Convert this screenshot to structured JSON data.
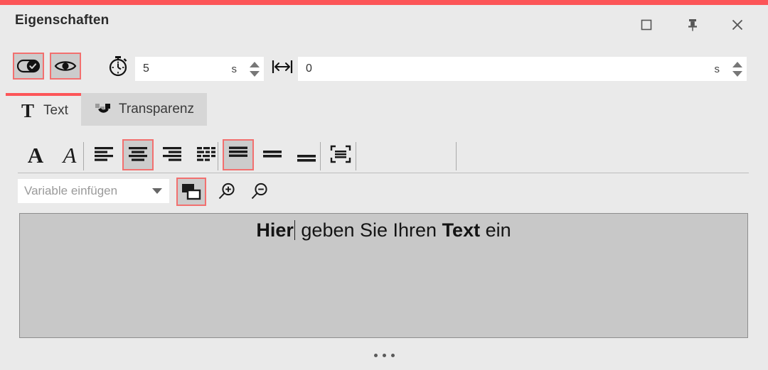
{
  "window": {
    "title": "Eigenschaften",
    "accent_color": "#fc5558",
    "background_color": "#eaeaea",
    "controls": [
      {
        "name": "maximize",
        "icon": "maximize-square-icon"
      },
      {
        "name": "pin",
        "icon": "pin-icon"
      },
      {
        "name": "close",
        "icon": "close-x-icon"
      }
    ]
  },
  "options_toolbar": {
    "toggles": [
      {
        "name": "state-toggle",
        "icon": "toggle-check-icon",
        "selected": true
      },
      {
        "name": "visibility-toggle",
        "icon": "eye-icon",
        "selected": true
      }
    ],
    "duration": {
      "icon": "stopwatch-icon",
      "value": "5",
      "unit": "s"
    },
    "delay": {
      "icon": "horizontal-arrows-icon",
      "value": "0",
      "unit": "s"
    }
  },
  "tabs": [
    {
      "label": "Text",
      "icon": "serif-t-icon",
      "glyph": "T",
      "active": true
    },
    {
      "label": "Transparenz",
      "icon": "transparency-icon",
      "active": false
    }
  ],
  "format_toolbar": {
    "buttons": [
      {
        "name": "bold",
        "icon": "bold-a-icon",
        "glyph": "A",
        "selected": false
      },
      {
        "name": "italic",
        "icon": "italic-a-icon",
        "glyph": "A",
        "selected": false
      },
      {
        "name": "align-left",
        "icon": "align-left-icon",
        "selected": false
      },
      {
        "name": "align-center",
        "icon": "align-center-icon",
        "selected": true
      },
      {
        "name": "align-right",
        "icon": "align-right-icon",
        "selected": false
      },
      {
        "name": "align-justify",
        "icon": "align-justify-icon",
        "selected": false
      },
      {
        "name": "valign-top",
        "icon": "vertical-align-top-icon",
        "selected": true
      },
      {
        "name": "valign-middle",
        "icon": "vertical-align-middle-icon",
        "selected": false
      },
      {
        "name": "valign-bottom",
        "icon": "vertical-align-bottom-icon",
        "selected": false
      },
      {
        "name": "fit-text",
        "icon": "fit-text-frame-icon",
        "selected": false
      }
    ],
    "color": {
      "name": "text-color",
      "value": "#000000",
      "highlighted": true
    },
    "font": {
      "icon": "tt-font-icon",
      "family": "Open Sans",
      "size": "36"
    }
  },
  "variable_row": {
    "variable_placeholder": "Variable einfügen",
    "buttons": [
      {
        "name": "duplicate-layer",
        "icon": "layers-duplicate-icon",
        "selected": true
      },
      {
        "name": "zoom-in",
        "icon": "zoom-in-magnifier-icon",
        "selected": false
      },
      {
        "name": "zoom-out",
        "icon": "zoom-out-magnifier-icon",
        "selected": false
      }
    ]
  },
  "text_canvas": {
    "segments": [
      {
        "text": "Hier",
        "bold": true
      },
      {
        "text": " geben Sie Ihren ",
        "bold": false
      },
      {
        "text": "Text",
        "bold": true
      },
      {
        "text": " ein",
        "bold": false
      }
    ],
    "full_text": "Hier geben Sie Ihren Text ein",
    "background_color": "#c8c8c8"
  },
  "footer": {
    "handle_icon": "ellipsis-handle-icon"
  }
}
